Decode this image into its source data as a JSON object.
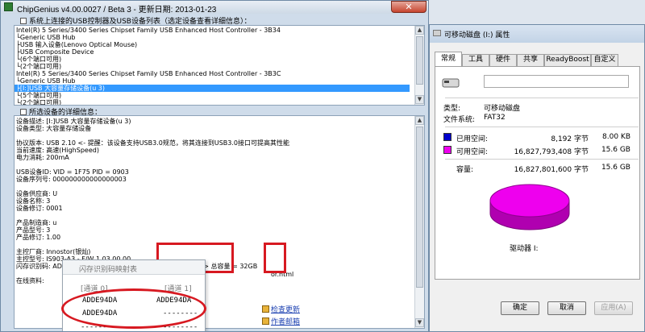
{
  "chipgenius": {
    "title": "ChipGenius v4.00.0027 / Beta 3 - 更新日期: 2013-01-23",
    "close_label": "✕",
    "device_list_header": "系统上连接的USB控制器及USB设备列表（选定设备查看详细信息）：",
    "tree": [
      "Intel(R) 5 Series/3400 Series Chipset Family USB Enhanced Host Controller - 3B34",
      "└Generic USB Hub",
      "  ├USB 输入设备(Lenovo Optical Mouse)",
      "  ├USB Composite Device",
      "  └(6个端口可用)",
      "└(2个端口可用)",
      "Intel(R) 5 Series/3400 Series Chipset Family USB Enhanced Host Controller - 3B3C",
      "└Generic USB Hub",
      "  ├[I:]USB 大容量存储设备(u 3)",
      "  └(5个端口可用)",
      "└(2个端口可用)"
    ],
    "detail_header": "所选设备的详细信息：",
    "details": [
      "   设备描述: [I:]USB 大容量存储设备(u 3)",
      "   设备类型:   大容量存储设备",
      "",
      "   协议版本: USB 2.10 <- 提醒：该设备支持USB3.0规范，将其连接到USB3.0接口可提高其性能",
      "   当前速度: 高速(HighSpeed)",
      "   电力消耗: 200mA",
      "",
      " USB设备ID: VID = 1F75 PID = 0903",
      " 设备序列号: 000000000000000003",
      "",
      " 设备供应商: U",
      "   设备名称: 3",
      "   设备修订: 0001",
      "",
      " 产品制造商: u",
      "   产品型号: 3",
      "   产品修订: 1.00",
      "",
      "   主控厂商: Innostor(银灿)",
      "   主控型号: IS903-A3 - F/W 1.03.00.00",
      " 闪存识别码:    ADDE94DA - Hynix(海力士) - 2CE/双通道 [MLC] -> 总容量 = 32GB",
      "",
      "   在线资料:"
    ],
    "online_link_tail": "or.html",
    "popup": {
      "title": "闪存识别码映射表",
      "col1": "[通道 0]",
      "col2": "[通道 1]",
      "rows": [
        [
          "ADDE94DA",
          "ADDE94DA"
        ],
        [
          "ADDE94DA",
          "--------"
        ],
        [
          "--------",
          "--------"
        ]
      ]
    },
    "links": {
      "check_update": "检查更新",
      "author_email": "作者邮箱"
    }
  },
  "properties": {
    "title": "可移动磁盘 (I:) 属性",
    "tabs": [
      "常规",
      "工具",
      "硬件",
      "共享",
      "ReadyBoost",
      "自定义"
    ],
    "drive_label_value": "",
    "type_label": "类型:",
    "type_value": "可移动磁盘",
    "fs_label": "文件系统:",
    "fs_value": "FAT32",
    "used_label": "已用空间:",
    "used_bytes": "8,192 字节",
    "used_size": "8.00 KB",
    "free_label": "可用空间:",
    "free_bytes": "16,827,793,408 字节",
    "free_size": "15.6 GB",
    "cap_label": "容量:",
    "cap_bytes": "16,827,801,600 字节",
    "cap_size": "15.6 GB",
    "drive_caption": "驱动器 I:",
    "buttons": {
      "ok": "确定",
      "cancel": "取消",
      "apply": "应用(A)"
    },
    "colors": {
      "used": "#0000cc",
      "free": "#ee00ee"
    }
  }
}
